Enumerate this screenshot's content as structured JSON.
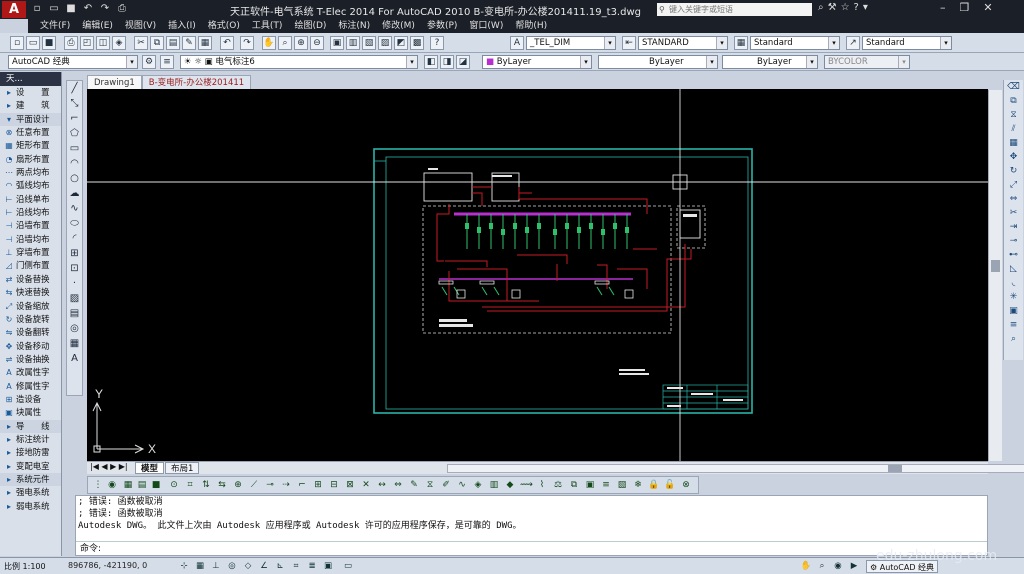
{
  "title": "天正软件-电气系统 T-Elec 2014  For AutoCAD 2010     B-变电所-办公楼201411.19_t3.dwg",
  "search_placeholder": "键入关键字或短语",
  "menu": [
    "文件(F)",
    "编辑(E)",
    "视图(V)",
    "插入(I)",
    "格式(O)",
    "工具(T)",
    "绘图(D)",
    "标注(N)",
    "修改(M)",
    "参数(P)",
    "窗口(W)",
    "帮助(H)"
  ],
  "toolbar": {
    "text_style": "_TEL_DIM",
    "dim_style": "STANDARD",
    "table_style": "Standard",
    "mleader_style": "Standard",
    "workspace": "AutoCAD 经典",
    "layer": "电气标注6",
    "color": "ByLayer",
    "linetype": "ByLayer",
    "lineweight": "ByLayer",
    "plotstyle": "BYCOLOR"
  },
  "tabs": [
    "Drawing1",
    "B-变电所-办公楼201411"
  ],
  "panel": {
    "title": "天...",
    "items": [
      "设　　置",
      "建　　筑",
      "平面设计",
      "任意布置",
      "矩形布置",
      "扇形布置",
      "两点均布",
      "弧线均布",
      "沿线单布",
      "沿线均布",
      "沿墙布置",
      "沿墙均布",
      "穿墙布置",
      "门侧布置",
      "设备替换",
      "快速替换",
      "设备缩放",
      "设备旋转",
      "设备翻转",
      "设备移动",
      "设备抽换",
      "改属性字",
      "修属性字",
      "造设备",
      "块属性",
      "导　　线",
      "标注统计",
      "接地防雷",
      "变配电室",
      "系统元件",
      "强电系统",
      "弱电系统"
    ]
  },
  "ucs": {
    "x": "X",
    "y": "Y"
  },
  "layout_tabs": [
    "模型",
    "布局1"
  ],
  "cmd_lines": [
    "; 错误: 函数被取消",
    "; 错误: 函数被取消",
    "Autodesk DWG。  此文件上次由 Autodesk 应用程序或 Autodesk 许可的应用程序保存，是可靠的 DWG。"
  ],
  "cmd_prompt": "命令:",
  "status": {
    "scale": "比例 1:100",
    "coords": "896786, -421190, 0",
    "workspace": "AutoCAD 经典"
  },
  "watermark": "edu-zhulong.com",
  "colors": {
    "canvas": "#000000",
    "frame": "#29b5a8",
    "wiring": "#c41c24",
    "busbar": "#b82fd0",
    "breakers": "#2fc06d"
  }
}
